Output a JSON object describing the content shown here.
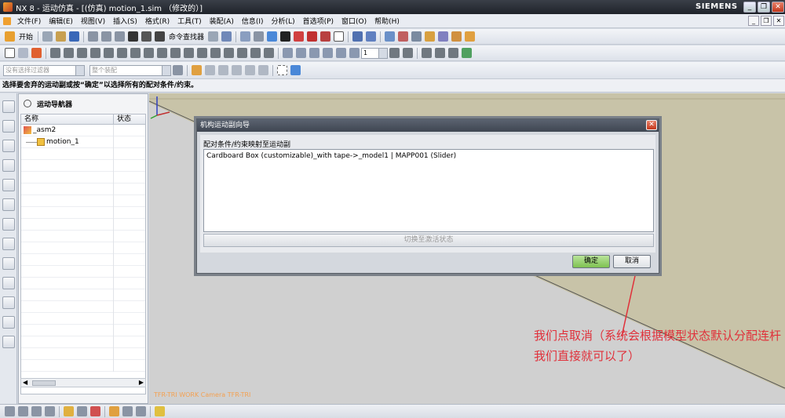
{
  "window": {
    "title": "NX 8 - 运动仿真 - [(仿真) motion_1.sim （修改的）]",
    "brand": "SIEMENS",
    "min_label": "_",
    "restore_label": "❐",
    "close_label": "✕"
  },
  "menu": {
    "items": [
      "文件(F)",
      "编辑(E)",
      "视图(V)",
      "插入(S)",
      "格式(R)",
      "工具(T)",
      "装配(A)",
      "信息(I)",
      "分析(L)",
      "首选项(P)",
      "窗口(O)",
      "帮助(H)"
    ]
  },
  "toolbar": {
    "start_label": "开始",
    "command_finder_label": "命令查找器",
    "selection_filter_placeholder": "没有选择过滤器",
    "scope_placeholder": "整个装配",
    "frame_value": "1"
  },
  "cue_line": "选择要舍弃的运动副或按“确定”以选择所有的配对条件/约束。",
  "navigator": {
    "title": "运动导航器",
    "columns": [
      "名称",
      "状态"
    ],
    "rows": [
      {
        "name": "_asm2"
      },
      {
        "name": "motion_1"
      }
    ]
  },
  "graphics": {
    "viewport_label": "TFR-TRI WORK Camera TFR-TRI",
    "annotation": "我们点取消（系统会根据模型状态默认分配连杆我们直接就可以了）",
    "colors": {
      "background_tan": "#c8c3a8",
      "plane_gray": "#d0d0d0",
      "annotation_red": "#e0303a"
    }
  },
  "dialog": {
    "title": "机构运动副向导",
    "section_label": "配对条件/约束映射至运动副",
    "list_row": "Cardboard Box (customizable)_with tape->_model1    | MAPP001 (Slider)",
    "switch_label": "切换至激活状态",
    "ok_label": "确定",
    "cancel_label": "取消"
  }
}
